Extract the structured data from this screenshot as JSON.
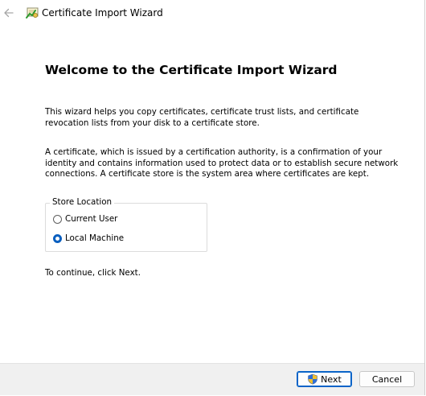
{
  "window": {
    "title": "Certificate Import Wizard",
    "back_icon": "back-arrow-icon",
    "app_icon": "certificate-icon"
  },
  "content": {
    "heading": "Welcome to the Certificate Import Wizard",
    "paragraph1": "This wizard helps you copy certificates, certificate trust lists, and certificate revocation lists from your disk to a certificate store.",
    "paragraph2": "A certificate, which is issued by a certification authority, is a confirmation of your identity and contains information used to protect data or to establish secure network connections. A certificate store is the system area where certificates are kept.",
    "store_location": {
      "legend": "Store Location",
      "options": [
        {
          "label": "Current User",
          "selected": false
        },
        {
          "label": "Local Machine",
          "selected": true
        }
      ]
    },
    "continue_text": "To continue, click Next."
  },
  "footer": {
    "next_label": "Next",
    "next_icon": "uac-shield-icon",
    "cancel_label": "Cancel"
  },
  "colors": {
    "accent": "#0a5fbf",
    "footer_bg": "#f0f0f0"
  }
}
